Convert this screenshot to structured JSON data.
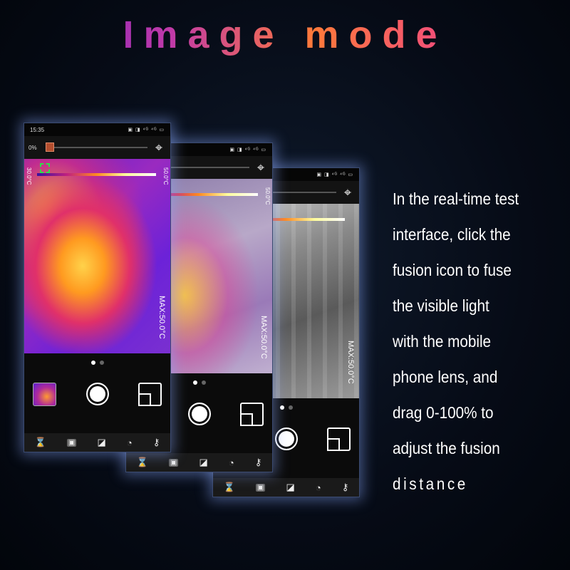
{
  "title": "Image mode",
  "accent_colors": [
    "#6a1cc8",
    "#ff7a3a",
    "#f04a80"
  ],
  "phones": [
    {
      "time": "15:35",
      "status_icons": "▣ ◨ ⁴ᴳ ⁴ᴳ ▭",
      "fusion_percent": "0%",
      "temp_min": "30.0°C",
      "temp_max": "50.0°C",
      "max_label": "MAX:50.0°C",
      "mode": "thermal"
    },
    {
      "time": "",
      "status_icons": "▣ ◨ ⁴ᴳ ⁴ᴳ ▭",
      "fusion_percent": "",
      "temp_min": "",
      "temp_max": "50.0°C",
      "max_label": "MAX:50.0°C",
      "mode": "fusion"
    },
    {
      "time": "",
      "status_icons": "▣ ◨ ⁴ᴳ ⁴ᴳ ▭",
      "fusion_percent": "",
      "temp_min": "",
      "temp_max": "",
      "max_label": "MAX:50.0°C",
      "mode": "visible"
    }
  ],
  "nav_icons": [
    "hourglass-icon",
    "gallery-icon",
    "region-icon",
    "palette-icon",
    "tools-icon"
  ],
  "description": [
    "In the real-time test",
    "interface, click the",
    "fusion icon to fuse",
    "the visible light",
    "with the mobile",
    "phone lens, and",
    "drag 0-100% to",
    "adjust the fusion",
    "distance"
  ]
}
